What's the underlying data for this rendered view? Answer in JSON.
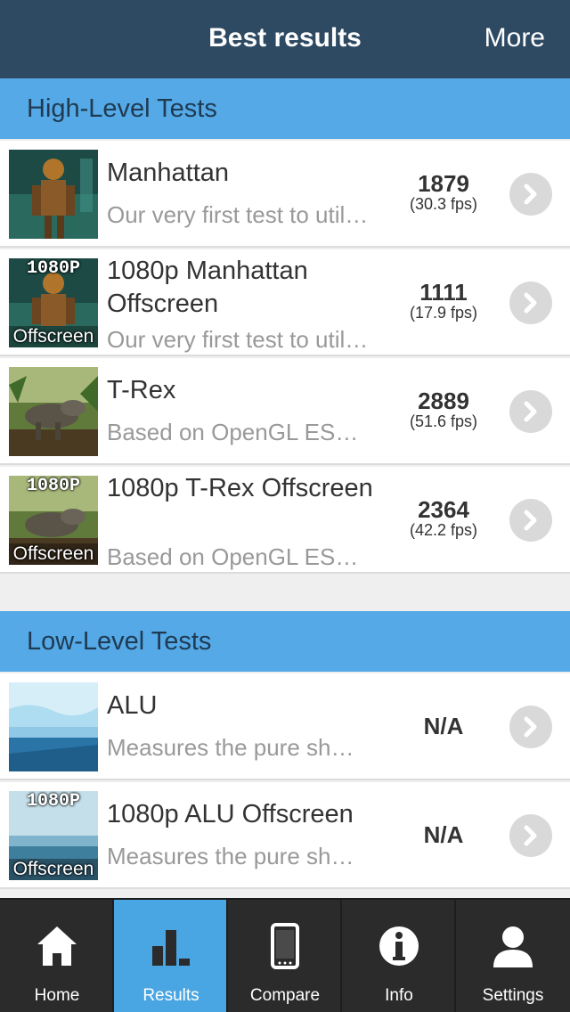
{
  "header": {
    "title": "Best results",
    "more_label": "More"
  },
  "sections": [
    {
      "title": "High-Level Tests"
    },
    {
      "title": "Low-Level Tests"
    }
  ],
  "high_level_tests": [
    {
      "name": "Manhattan",
      "desc": "Our very first test to util…",
      "score": "1879",
      "fps": "(30.3 fps)",
      "badge_top": "",
      "badge_bottom": ""
    },
    {
      "name": "1080p Manhattan Offscreen",
      "desc": "Our very first test to util…",
      "score": "1111",
      "fps": "(17.9 fps)",
      "badge_top": "1080P",
      "badge_bottom": "Offscreen"
    },
    {
      "name": "T-Rex",
      "desc": "Based on OpenGL ES…",
      "score": "2889",
      "fps": "(51.6 fps)",
      "badge_top": "",
      "badge_bottom": ""
    },
    {
      "name": "1080p T-Rex Offscreen",
      "desc": "Based on OpenGL ES…",
      "score": "2364",
      "fps": "(42.2 fps)",
      "badge_top": "1080P",
      "badge_bottom": "Offscreen"
    }
  ],
  "low_level_tests": [
    {
      "name": "ALU",
      "desc": "Measures the pure sh…",
      "score": "N/A",
      "badge_top": "",
      "badge_bottom": ""
    },
    {
      "name": "1080p ALU Offscreen",
      "desc": "Measures the pure sh…",
      "score": "N/A",
      "badge_top": "1080P",
      "badge_bottom": "Offscreen"
    }
  ],
  "tabs": [
    {
      "label": "Home",
      "icon": "home-icon",
      "active": false
    },
    {
      "label": "Results",
      "icon": "bar-chart-icon",
      "active": true
    },
    {
      "label": "Compare",
      "icon": "phone-icon",
      "active": false
    },
    {
      "label": "Info",
      "icon": "info-icon",
      "active": false
    },
    {
      "label": "Settings",
      "icon": "user-icon",
      "active": false
    }
  ],
  "colors": {
    "header_bg": "#2e4a63",
    "section_bg": "#54a9e6",
    "tab_active": "#4aa6e3",
    "tabbar_bg": "#2b2b2b"
  }
}
